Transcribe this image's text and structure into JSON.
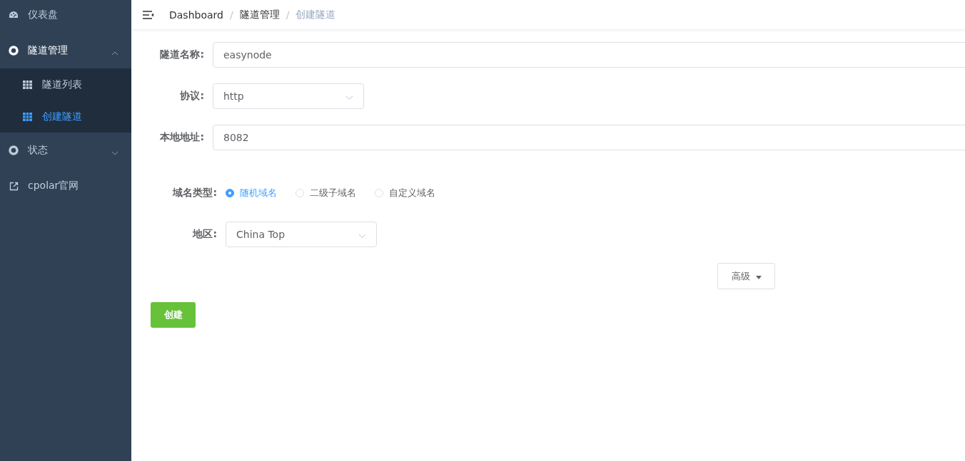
{
  "sidebar": {
    "items": [
      {
        "label": "仪表盘",
        "selected": false
      },
      {
        "label": "隧道管理",
        "selected": false,
        "expanded": true,
        "children": [
          {
            "label": "隧道列表",
            "selected": false
          },
          {
            "label": "创建隧道",
            "selected": true
          }
        ]
      },
      {
        "label": "状态",
        "selected": false,
        "expanded": false
      },
      {
        "label": "cpolar官网",
        "selected": false
      }
    ]
  },
  "breadcrumb": {
    "items": [
      "Dashboard",
      "隧道管理",
      "创建隧道"
    ],
    "separator": "/"
  },
  "form": {
    "fields": [
      {
        "label": "隧道名称:",
        "kind": "input",
        "value": "easynode"
      },
      {
        "label": "协议:",
        "kind": "select",
        "value": "http"
      },
      {
        "label": "本地地址:",
        "kind": "input",
        "value": "8082"
      }
    ],
    "domain_type": {
      "label": "域名类型:",
      "options": [
        {
          "label": "随机域名",
          "selected": true
        },
        {
          "label": "二级子域名",
          "selected": false
        },
        {
          "label": "自定义域名",
          "selected": false
        }
      ]
    },
    "region": {
      "label": "地区:",
      "value": "China Top"
    },
    "advanced_button": "高级",
    "create_button": "创建"
  }
}
